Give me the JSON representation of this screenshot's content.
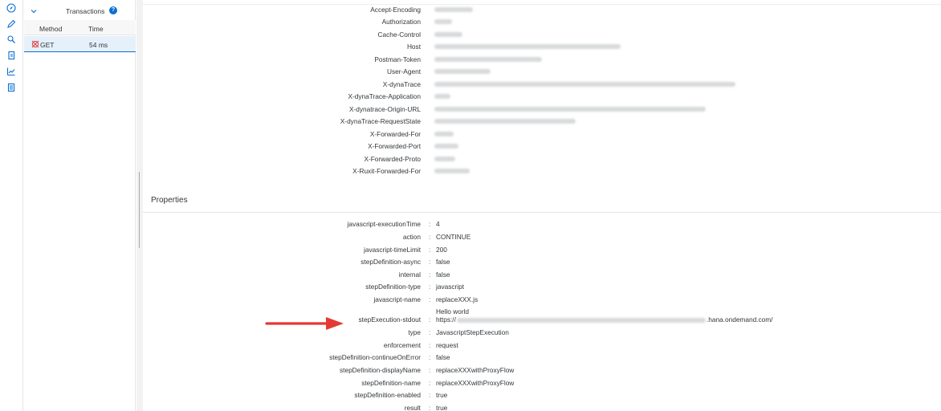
{
  "rail": {
    "icons": [
      "compass-icon",
      "pencil-icon",
      "search-debug-icon",
      "copy-document-icon",
      "chart-icon",
      "list-document-icon"
    ]
  },
  "transactions": {
    "title": "Transactions",
    "info_glyph": "?",
    "columns": {
      "method": "Method",
      "time": "Time"
    },
    "rows": [
      {
        "method": "GET",
        "time": "54 ms"
      }
    ]
  },
  "headers": {
    "keys": [
      "Accept-Encoding",
      "Authorization",
      "Cache-Control",
      "Host",
      "Postman-Token",
      "User-Agent",
      "X-dynaTrace",
      "X-dynaTrace-Application",
      "X-dynatrace-Origin-URL",
      "X-dynaTrace-RequestState",
      "X-Forwarded-For",
      "X-Forwarded-Port",
      "X-Forwarded-Proto",
      "X-Ruxit-Forwarded-For"
    ]
  },
  "properties": {
    "title": "Properties",
    "separator": ":",
    "rows": [
      {
        "key": "javascript-executionTime",
        "value": "4"
      },
      {
        "key": "action",
        "value": "CONTINUE"
      },
      {
        "key": "javascript-timeLimit",
        "value": "200"
      },
      {
        "key": "stepDefinition-async",
        "value": "false"
      },
      {
        "key": "internal",
        "value": "false"
      },
      {
        "key": "stepDefinition-type",
        "value": "javascript"
      },
      {
        "key": "javascript-name",
        "value": "replaceXXX.js"
      },
      {
        "key": "stepExecution-stdout",
        "value_line1": "Hello world",
        "value_prefix": "https://",
        "value_suffix": ".hana.ondemand.com/"
      },
      {
        "key": "type",
        "value": "JavascriptStepExecution"
      },
      {
        "key": "enforcement",
        "value": "request"
      },
      {
        "key": "stepDefinition-continueOnError",
        "value": "false"
      },
      {
        "key": "stepDefinition-displayName",
        "value": "replaceXXXwithProxyFlow"
      },
      {
        "key": "stepDefinition-name",
        "value": "replaceXXXwithProxyFlow"
      },
      {
        "key": "stepDefinition-enabled",
        "value": "true"
      },
      {
        "key": "result",
        "value": "true"
      }
    ]
  },
  "colors": {
    "accent": "#0a6ed1",
    "arrow": "#e53935",
    "text": "#32363a"
  }
}
